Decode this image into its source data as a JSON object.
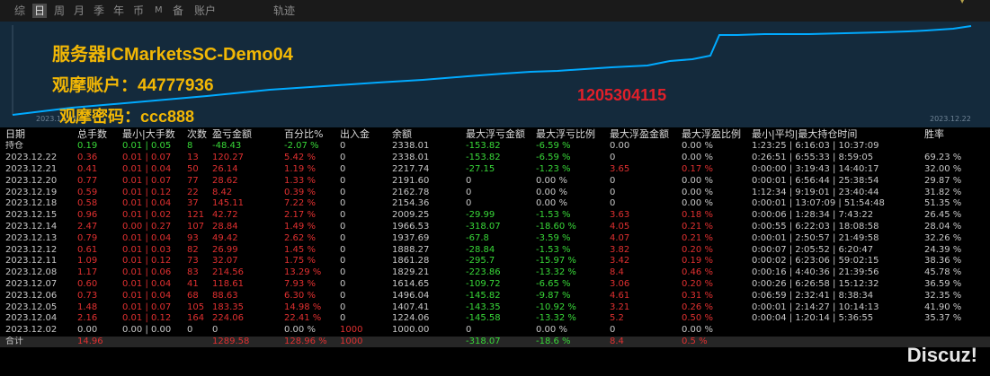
{
  "tabs": [
    {
      "label": "综",
      "active": false
    },
    {
      "label": "日",
      "active": true
    },
    {
      "label": "周",
      "active": false
    },
    {
      "label": "月",
      "active": false
    },
    {
      "label": "季",
      "active": false
    },
    {
      "label": "年",
      "active": false
    },
    {
      "label": "币",
      "active": false
    },
    {
      "label": "M",
      "active": false
    },
    {
      "label": "备",
      "active": false
    },
    {
      "label": "账户",
      "active": false
    },
    {
      "label": "轨迹",
      "active": false
    }
  ],
  "overlay": {
    "server": "服务器ICMarketsSC-Demo04",
    "account": "观摩账户：44777936",
    "password": "观摩密码：ccc888",
    "number": "1205304115"
  },
  "chart": {
    "start_label": "2023.12.01",
    "end_label": "2023.12.22",
    "line_color": "#00aaff",
    "bg_color": "#142a3c"
  },
  "table": {
    "headers": [
      "日期",
      "总手数",
      "最小|大手数",
      "次数",
      "盈亏金额",
      "百分比%",
      "出入金",
      "余额",
      "最大浮亏金额",
      "最大浮亏比例",
      "最大浮盈金额",
      "最大浮盈比例",
      "最小|平均|最大持仓时间",
      "胜率"
    ],
    "position": [
      "持仓",
      "0.19",
      "0.01 | 0.05",
      "8",
      "-48.43",
      "-2.07 %",
      "0",
      "2338.01",
      "-153.82",
      "-6.59 %",
      "0.00",
      "0.00 %",
      "1:23:25 | 6:16:03 | 10:37:09",
      ""
    ],
    "rows": [
      [
        "2023.12.22",
        "0.36",
        "0.01 | 0.07",
        "13",
        "120.27",
        "5.42 %",
        "0",
        "2338.01",
        "-153.82",
        "-6.59 %",
        "0",
        "0.00 %",
        "0:26:51 | 6:55:33 | 8:59:05",
        "69.23 %"
      ],
      [
        "2023.12.21",
        "0.41",
        "0.01 | 0.04",
        "50",
        "26.14",
        "1.19 %",
        "0",
        "2217.74",
        "-27.15",
        "-1.23 %",
        "3.65",
        "0.17 %",
        "0:00:00 | 3:19:43 | 14:40:17",
        "32.00 %"
      ],
      [
        "2023.12.20",
        "0.77",
        "0.01 | 0.07",
        "77",
        "28.62",
        "1.33 %",
        "0",
        "2191.60",
        "0",
        "0.00 %",
        "0",
        "0.00 %",
        "0:00:01 | 6:56:44 | 25:38:54",
        "29.87 %"
      ],
      [
        "2023.12.19",
        "0.59",
        "0.01 | 0.12",
        "22",
        "8.42",
        "0.39 %",
        "0",
        "2162.78",
        "0",
        "0.00 %",
        "0",
        "0.00 %",
        "1:12:34 | 9:19:01 | 23:40:44",
        "31.82 %"
      ],
      [
        "2023.12.18",
        "0.58",
        "0.01 | 0.04",
        "37",
        "145.11",
        "7.22 %",
        "0",
        "2154.36",
        "0",
        "0.00 %",
        "0",
        "0.00 %",
        "0:00:01 | 13:07:09 | 51:54:48",
        "51.35 %"
      ],
      [
        "2023.12.15",
        "0.96",
        "0.01 | 0.02",
        "121",
        "42.72",
        "2.17 %",
        "0",
        "2009.25",
        "-29.99",
        "-1.53 %",
        "3.63",
        "0.18 %",
        "0:00:06 | 1:28:34 | 7:43:22",
        "26.45 %"
      ],
      [
        "2023.12.14",
        "2.47",
        "0.00 | 0.27",
        "107",
        "28.84",
        "1.49 %",
        "0",
        "1966.53",
        "-318.07",
        "-18.60 %",
        "4.05",
        "0.21 %",
        "0:00:55 | 6:22:03 | 18:08:58",
        "28.04 %"
      ],
      [
        "2023.12.13",
        "0.79",
        "0.01 | 0.04",
        "93",
        "49.42",
        "2.62 %",
        "0",
        "1937.69",
        "-67.8",
        "-3.59 %",
        "4.07",
        "0.21 %",
        "0:00:01 | 2:50:57 | 21:49:58",
        "32.26 %"
      ],
      [
        "2023.12.12",
        "0.61",
        "0.01 | 0.03",
        "82",
        "26.99",
        "1.45 %",
        "0",
        "1888.27",
        "-28.84",
        "-1.53 %",
        "3.82",
        "0.20 %",
        "0:00:07 | 2:05:52 | 6:20:47",
        "24.39 %"
      ],
      [
        "2023.12.11",
        "1.09",
        "0.01 | 0.12",
        "73",
        "32.07",
        "1.75 %",
        "0",
        "1861.28",
        "-295.7",
        "-15.97 %",
        "3.42",
        "0.19 %",
        "0:00:02 | 6:23:06 | 59:02:15",
        "38.36 %"
      ],
      [
        "2023.12.08",
        "1.17",
        "0.01 | 0.06",
        "83",
        "214.56",
        "13.29 %",
        "0",
        "1829.21",
        "-223.86",
        "-13.32 %",
        "8.4",
        "0.46 %",
        "0:00:16 | 4:40:36 | 21:39:56",
        "45.78 %"
      ],
      [
        "2023.12.07",
        "0.60",
        "0.01 | 0.04",
        "41",
        "118.61",
        "7.93 %",
        "0",
        "1614.65",
        "-109.72",
        "-6.65 %",
        "3.06",
        "0.20 %",
        "0:00:26 | 6:26:58 | 15:12:32",
        "36.59 %"
      ],
      [
        "2023.12.06",
        "0.73",
        "0.01 | 0.04",
        "68",
        "88.63",
        "6.30 %",
        "0",
        "1496.04",
        "-145.82",
        "-9.87 %",
        "4.61",
        "0.31 %",
        "0:06:59 | 2:32:41 | 8:38:34",
        "32.35 %"
      ],
      [
        "2023.12.05",
        "1.48",
        "0.01 | 0.07",
        "105",
        "183.35",
        "14.98 %",
        "0",
        "1407.41",
        "-143.35",
        "-10.92 %",
        "3.21",
        "0.26 %",
        "0:00:01 | 2:14:27 | 10:14:13",
        "41.90 %"
      ],
      [
        "2023.12.04",
        "2.16",
        "0.01 | 0.12",
        "164",
        "224.06",
        "22.41 %",
        "0",
        "1224.06",
        "-145.58",
        "-13.32 %",
        "5.2",
        "0.50 %",
        "0:00:04 | 1:20:14 | 5:36:55",
        "35.37 %"
      ],
      [
        "2023.12.02",
        "0.00",
        "0.00 | 0.00",
        "0",
        "0",
        "0.00 %",
        "1000",
        "1000.00",
        "0",
        "0.00 %",
        "0",
        "0.00 %",
        "",
        ""
      ]
    ],
    "total": [
      "合计",
      "14.96",
      "",
      "",
      "1289.58",
      "128.96 %",
      "1000",
      "",
      "-318.07",
      "-18.6 %",
      "8.4",
      "0.5 %",
      "",
      ""
    ]
  },
  "logo": "Discuz!"
}
